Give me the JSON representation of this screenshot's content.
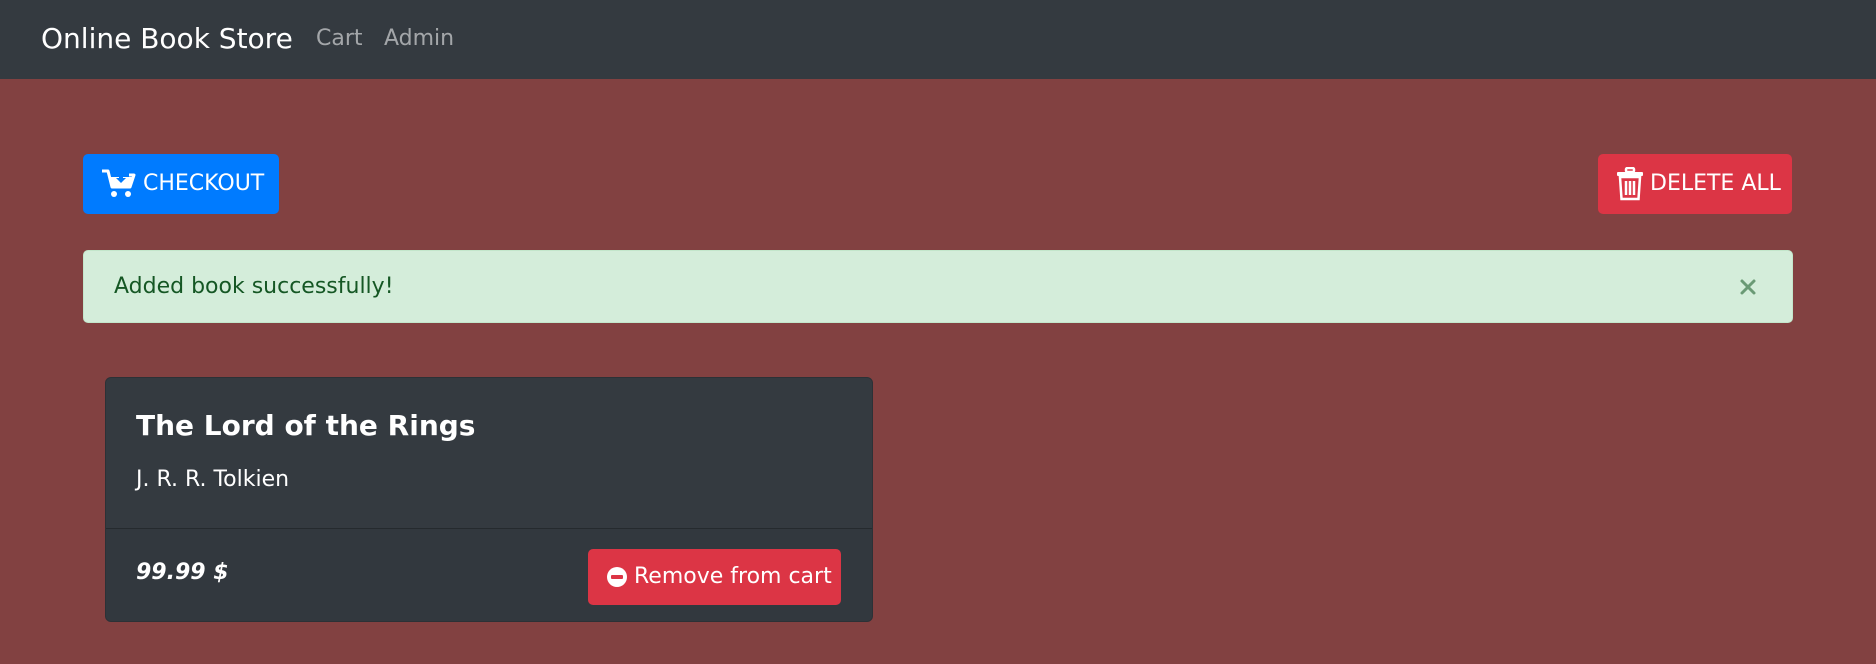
{
  "navbar": {
    "brand": "Online Book Store",
    "links": [
      "Cart",
      "Admin"
    ]
  },
  "actions": {
    "checkout_label": "CHECKOUT",
    "delete_all_label": "DELETE ALL"
  },
  "alert": {
    "message": "Added book successfully!",
    "close_icon": "close-icon"
  },
  "cart": {
    "items": [
      {
        "title": "The Lord of the Rings",
        "author": "J. R. R. Tolkien",
        "price": "99.99 $",
        "remove_label": "Remove from cart"
      }
    ]
  },
  "colors": {
    "background": "#824141",
    "navbar": "#343a40",
    "primary": "#007bff",
    "danger": "#dc3545",
    "success_bg": "#d4edda",
    "success_text": "#155724"
  },
  "icons": {
    "checkout": "cart-download-icon",
    "delete_all": "trash-icon",
    "remove": "minus-circle-icon"
  }
}
